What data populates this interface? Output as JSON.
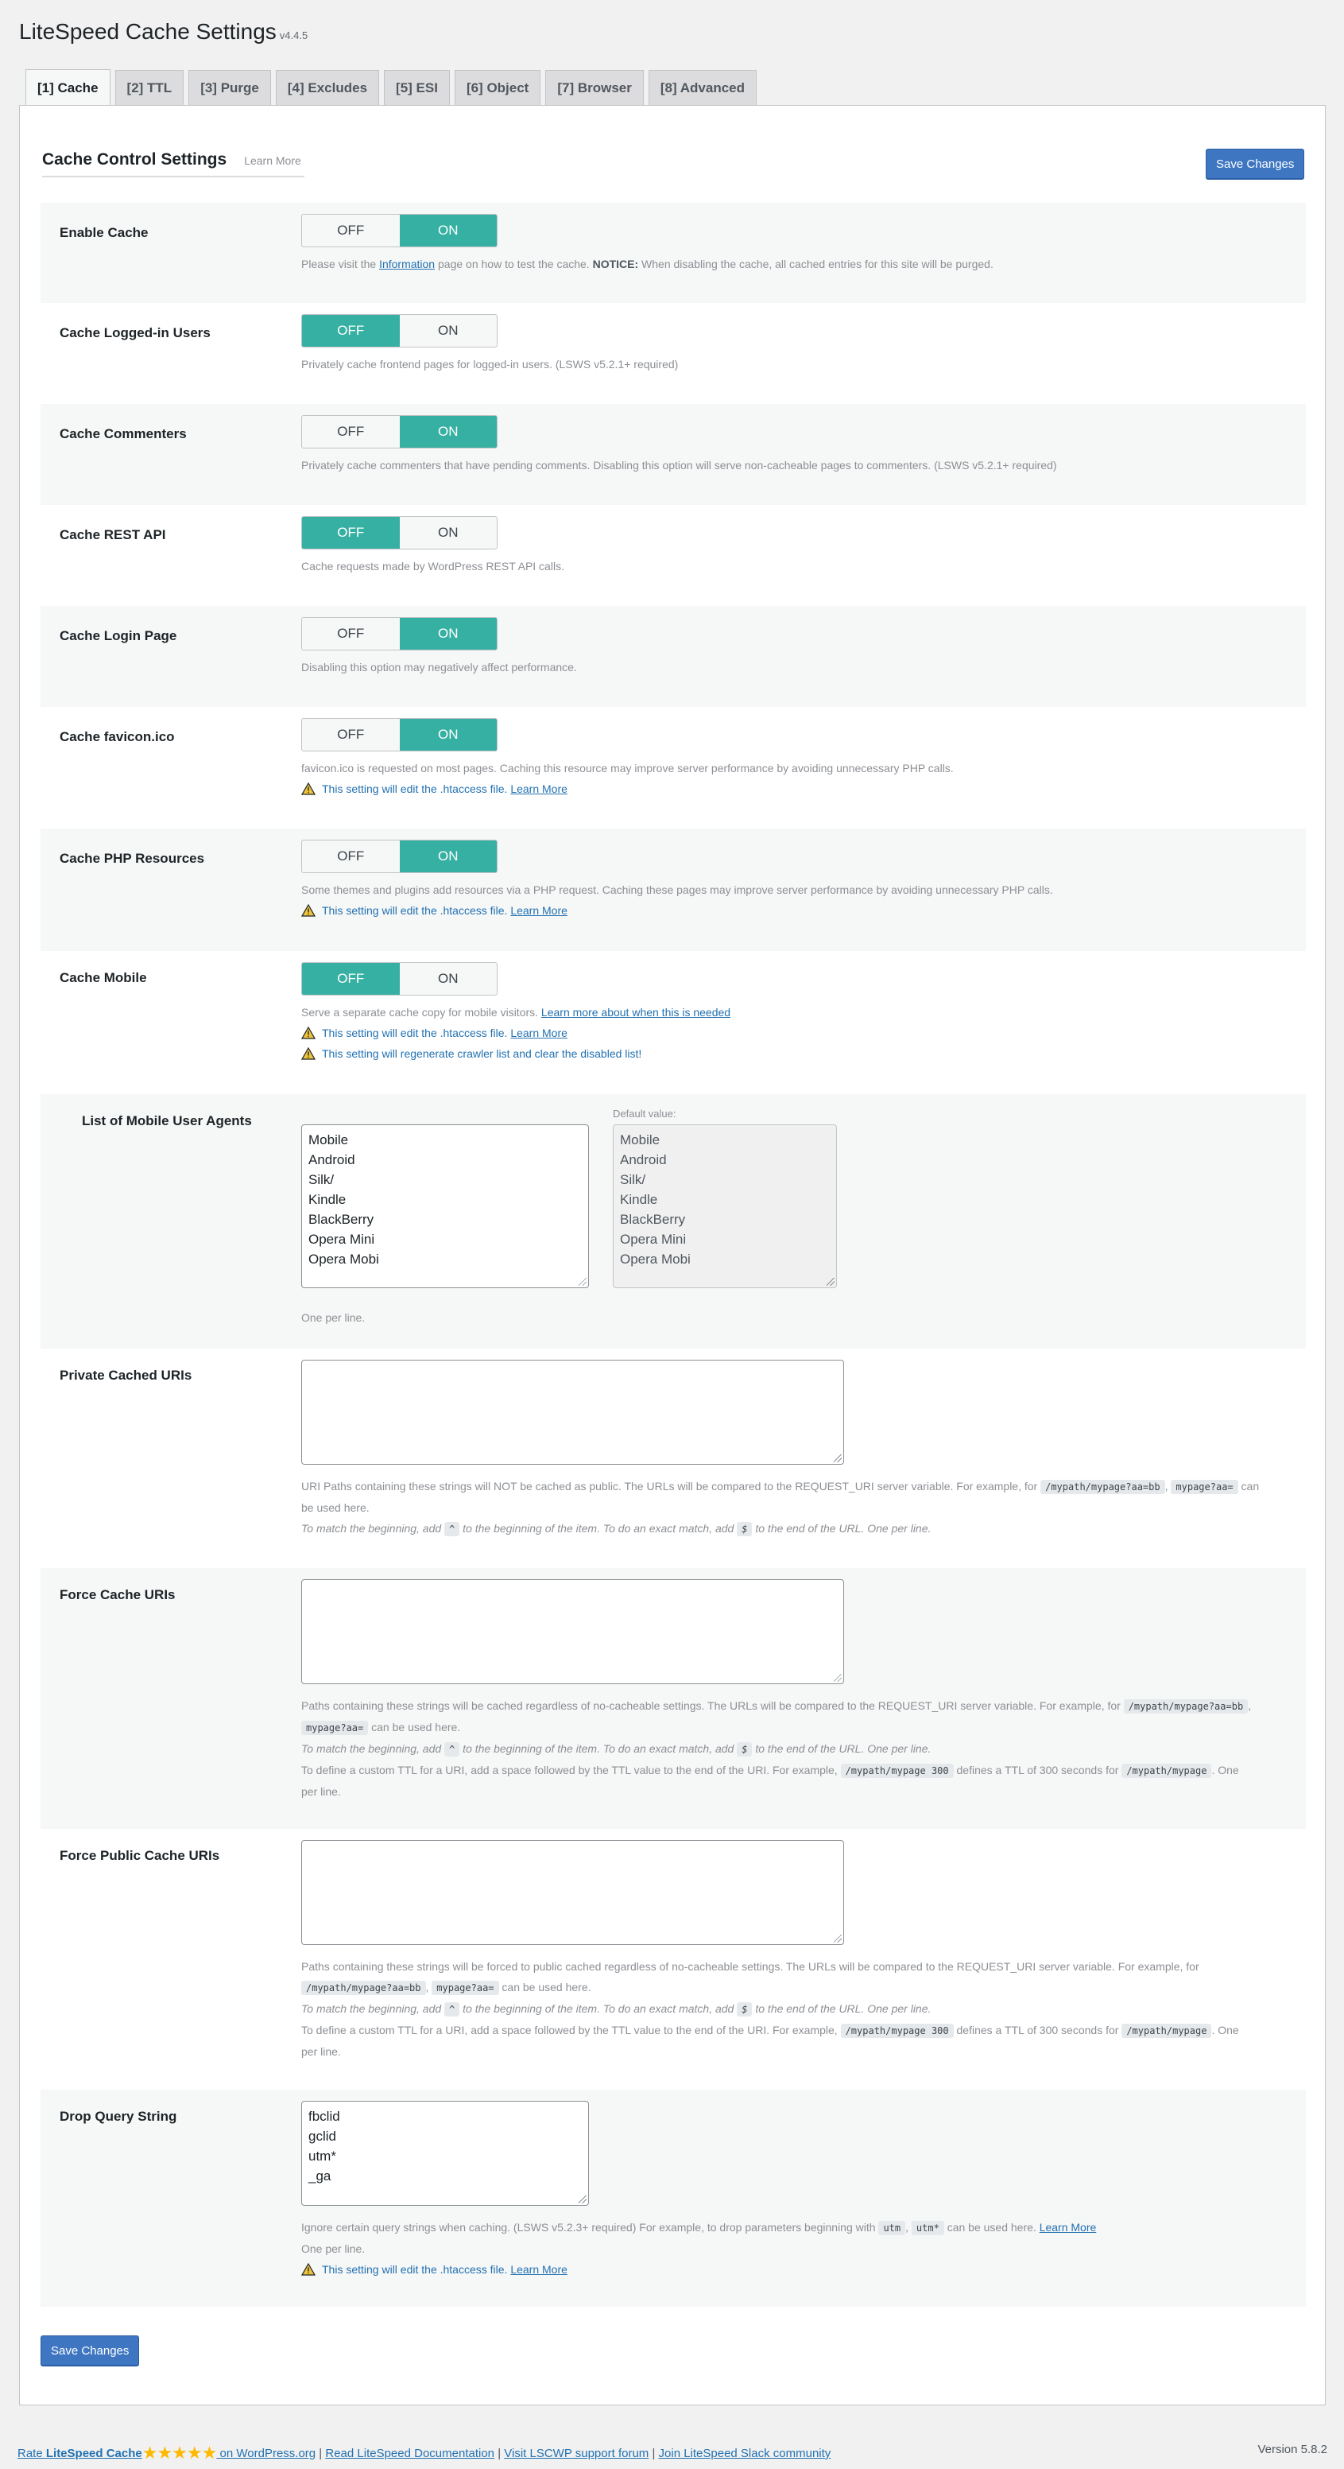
{
  "header": {
    "title": "LiteSpeed Cache Settings",
    "version": "v4.4.5"
  },
  "tabs": [
    "[1] Cache",
    "[2] TTL",
    "[3] Purge",
    "[4] Excludes",
    "[5] ESI",
    "[6] Object",
    "[7] Browser",
    "[8] Advanced"
  ],
  "section": {
    "title": "Cache Control Settings",
    "learn_more": "Learn More",
    "save_label": "Save Changes"
  },
  "toggle": {
    "off": "OFF",
    "on": "ON"
  },
  "settings": {
    "enable_cache": {
      "label": "Enable Cache",
      "state": "on",
      "desc_pre": "Please visit the ",
      "desc_link": "Information",
      "desc_mid": " page on how to test the cache. ",
      "desc_notice": "NOTICE:",
      "desc_post": " When disabling the cache, all cached entries for this site will be purged."
    },
    "cache_logged_in": {
      "label": "Cache Logged-in Users",
      "state": "off",
      "desc": "Privately cache frontend pages for logged-in users. (LSWS v5.2.1+ required)"
    },
    "cache_commenters": {
      "label": "Cache Commenters",
      "state": "on",
      "desc": "Privately cache commenters that have pending comments. Disabling this option will serve non-cacheable pages to commenters. (LSWS v5.2.1+ required)"
    },
    "cache_rest": {
      "label": "Cache REST API",
      "state": "off",
      "desc": "Cache requests made by WordPress REST API calls."
    },
    "cache_login": {
      "label": "Cache Login Page",
      "state": "on",
      "desc": "Disabling this option may negatively affect performance."
    },
    "cache_favicon": {
      "label": "Cache favicon.ico",
      "state": "on",
      "desc": "favicon.ico is requested on most pages. Caching this resource may improve server performance by avoiding unnecessary PHP calls."
    },
    "cache_php": {
      "label": "Cache PHP Resources",
      "state": "on",
      "desc": "Some themes and plugins add resources via a PHP request. Caching these pages may improve server performance by avoiding unnecessary PHP calls."
    },
    "cache_mobile": {
      "label": "Cache Mobile",
      "state": "off",
      "desc": "Serve a separate cache copy for mobile visitors. ",
      "desc_link": "Learn more about when this is needed",
      "warn2": "This setting will regenerate crawler list and clear the disabled list!"
    },
    "mobile_agents": {
      "label": "List of Mobile User Agents",
      "values": [
        "Mobile",
        "Android",
        "Silk/",
        "Kindle",
        "BlackBerry",
        "Opera Mini",
        "Opera Mobi"
      ],
      "default_label": "Default value:",
      "defaults": [
        "Mobile",
        "Android",
        "Silk/",
        "Kindle",
        "BlackBerry",
        "Opera Mini",
        "Opera Mobi"
      ],
      "desc": "One per line."
    },
    "private_uris": {
      "label": "Private Cached URIs",
      "desc_a": "URI Paths containing these strings will NOT be cached as public. The URLs will be compared to the REQUEST_URI server variable. For example, for ",
      "code1": "/mypath/mypage?aa=bb",
      "sep": ", ",
      "code2": "mypage?aa=",
      "desc_b": " can",
      "desc_c": "be used here."
    },
    "force_uris": {
      "label": "Force Cache URIs",
      "desc_a": "Paths containing these strings will be cached regardless of no-cacheable settings. The URLs will be compared to the REQUEST_URI server variable. For example, for ",
      "code1": "/mypath/mypage?aa=bb",
      "code2": "mypage?aa=",
      "desc_b": " can be used here."
    },
    "force_public_uris": {
      "label": "Force Public Cache URIs",
      "desc_a": "Paths containing these strings will be forced to public cached regardless of no-cacheable settings. The URLs will be compared to the REQUEST_URI server variable. For example, for",
      "code1": "/mypath/mypage?aa=bb",
      "code2": "mypage?aa=",
      "desc_b": " can be used here."
    },
    "drop_qs": {
      "label": "Drop Query String",
      "values": [
        "fbclid",
        "gclid",
        "utm*",
        "_ga"
      ],
      "desc_a": "Ignore certain query strings when caching. (LSWS v5.2.3+ required) For example, to drop parameters beginning with ",
      "code1": "utm",
      "code2": "utm*",
      "desc_b": " can be used here. ",
      "desc_link": "Learn More",
      "desc_c": "One per line."
    }
  },
  "common": {
    "htaccess_warn": "This setting will edit the .htaccess file.",
    "learn_more": "Learn More",
    "match_a": "To match the beginning, add ",
    "caret": "^",
    "match_b": " to the beginning of the item. To do an exact match, add ",
    "dollar": "$",
    "match_c": " to the end of the URL. One per line.",
    "ttl_a": "To define a custom TTL for a URI, add a space followed by the TTL value to the end of the URI. For example, ",
    "ttl_code1": "/mypath/mypage 300",
    "ttl_b": " defines a TTL of 300 seconds for ",
    "ttl_code2": "/mypath/mypage",
    "ttl_c": ". One",
    "ttl_d": "per line.",
    "comma": ", "
  },
  "footer": {
    "rate_pre": "Rate ",
    "rate_brand": "LiteSpeed Cache",
    "stars": "★★★★★",
    "rate_post": " on WordPress.org",
    "sep": " | ",
    "docs": "Read LiteSpeed Documentation",
    "forum": "Visit LSCWP support forum",
    "slack": "Join LiteSpeed Slack community",
    "version": "Version 5.8.2"
  }
}
